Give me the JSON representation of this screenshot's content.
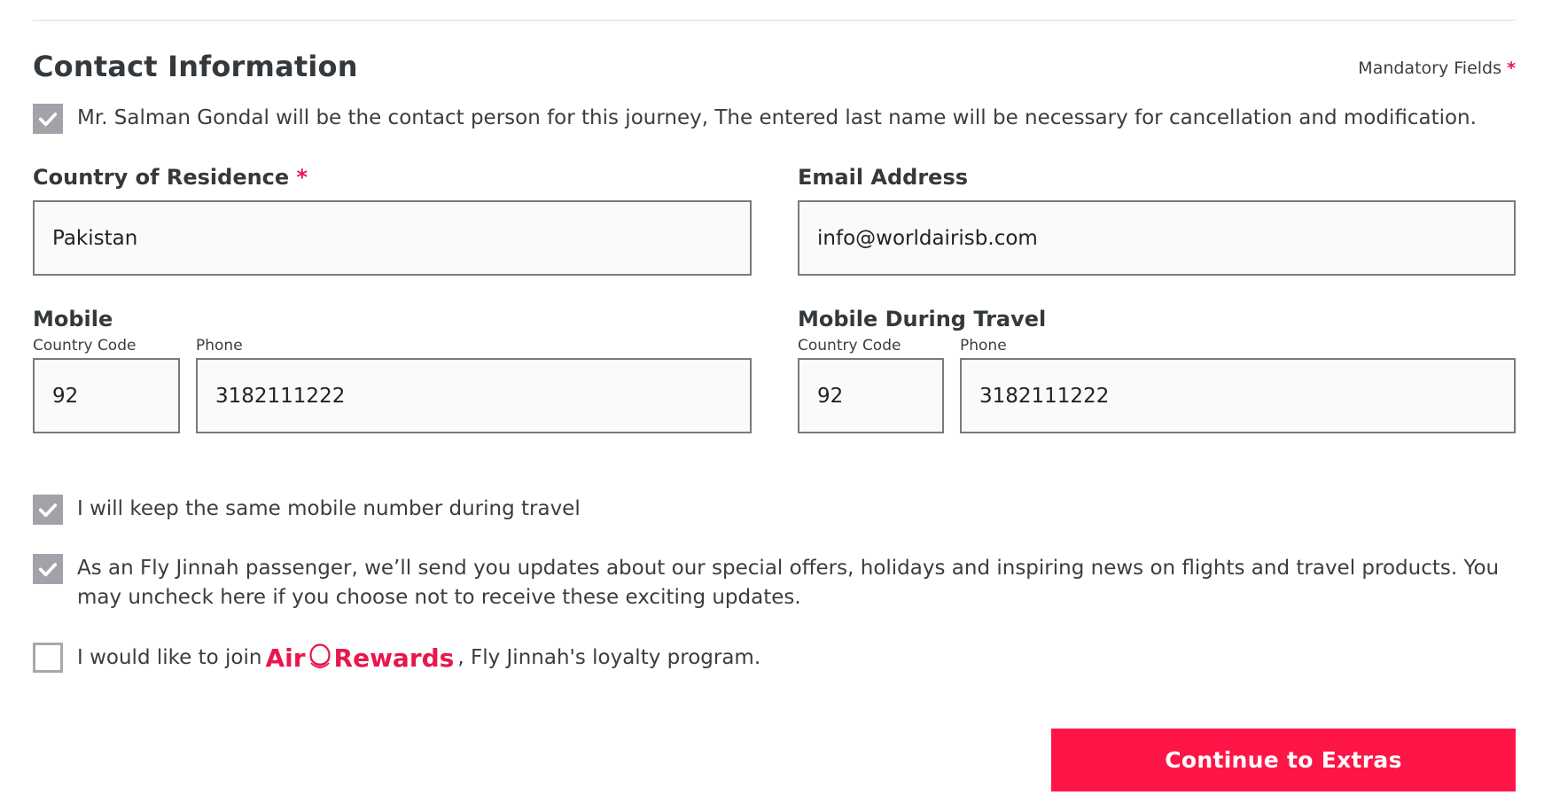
{
  "section": {
    "title": "Contact Information",
    "mandatory_label": "Mandatory Fields",
    "mandatory_star": "*"
  },
  "contact_person": {
    "checked": true,
    "text": "Mr. Salman Gondal will be the contact person for this journey, The entered last name will be necessary for cancellation and modification."
  },
  "country": {
    "label": "Country of Residence",
    "required_star": "*",
    "value": "Pakistan"
  },
  "email": {
    "label": "Email Address",
    "value": "info@worldairisb.com"
  },
  "mobile": {
    "label": "Mobile",
    "country_code_label": "Country Code",
    "phone_label": "Phone",
    "country_code": "92",
    "phone": "3182111222"
  },
  "mobile_travel": {
    "label": "Mobile During Travel",
    "country_code_label": "Country Code",
    "phone_label": "Phone",
    "country_code": "92",
    "phone": "3182111222"
  },
  "options": {
    "same_mobile": {
      "checked": true,
      "text": "I will keep the same mobile number during travel"
    },
    "updates": {
      "checked": true,
      "text": "As an Fly Jinnah passenger, we’ll send you updates about our special offers, holidays and inspiring news on flights and travel products. You may uncheck here if you choose not to receive these exciting updates."
    },
    "rewards": {
      "checked": false,
      "text_before": "I would like to join",
      "brand_air": "Air",
      "brand_rewards": "Rewards",
      "text_after": ", Fly Jinnah's loyalty program."
    }
  },
  "actions": {
    "continue_label": "Continue to Extras"
  },
  "colors": {
    "accent": "#fd1547",
    "brand_red": "#e8174d",
    "checkbox_checked": "#a2a2a8"
  }
}
